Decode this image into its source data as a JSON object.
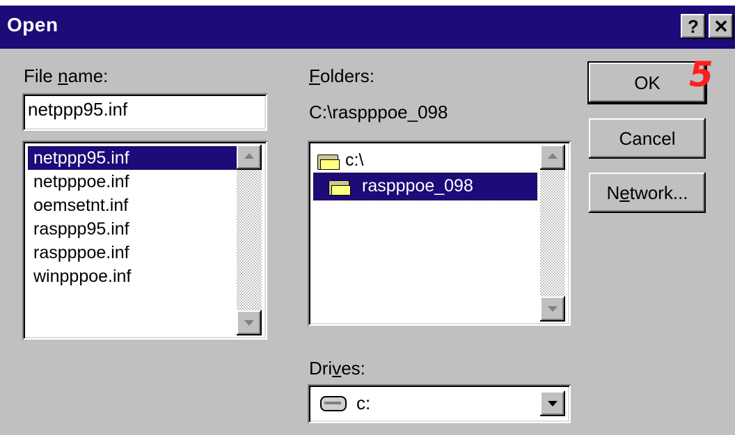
{
  "window": {
    "title": "Open",
    "help_button": "?",
    "close_button": "✕"
  },
  "filename": {
    "label": "File name:",
    "value": "netppp95.inf",
    "files": [
      "netppp95.inf",
      "netpppoe.inf",
      "oemsetnt.inf",
      "rasppp95.inf",
      "raspppoe.inf",
      "winpppoe.inf"
    ],
    "selected_index": 0
  },
  "folders": {
    "label": "Folders:",
    "current_path": "C:\\raspppoe_098",
    "items": [
      "c:\\",
      "raspppoe_098"
    ],
    "selected_index": 1
  },
  "drives": {
    "label": "Drives:",
    "value": "c:"
  },
  "buttons": {
    "ok": "OK",
    "cancel": "Cancel",
    "network": "Network..."
  },
  "annotation": {
    "step": "5",
    "color": "#ff1e1e"
  },
  "colors": {
    "title_bar": "#1e0a78",
    "selection": "#1e0a78",
    "face": "#c0c0c0"
  },
  "icons": {
    "folder": "folder-icon",
    "drive": "drive-icon"
  }
}
